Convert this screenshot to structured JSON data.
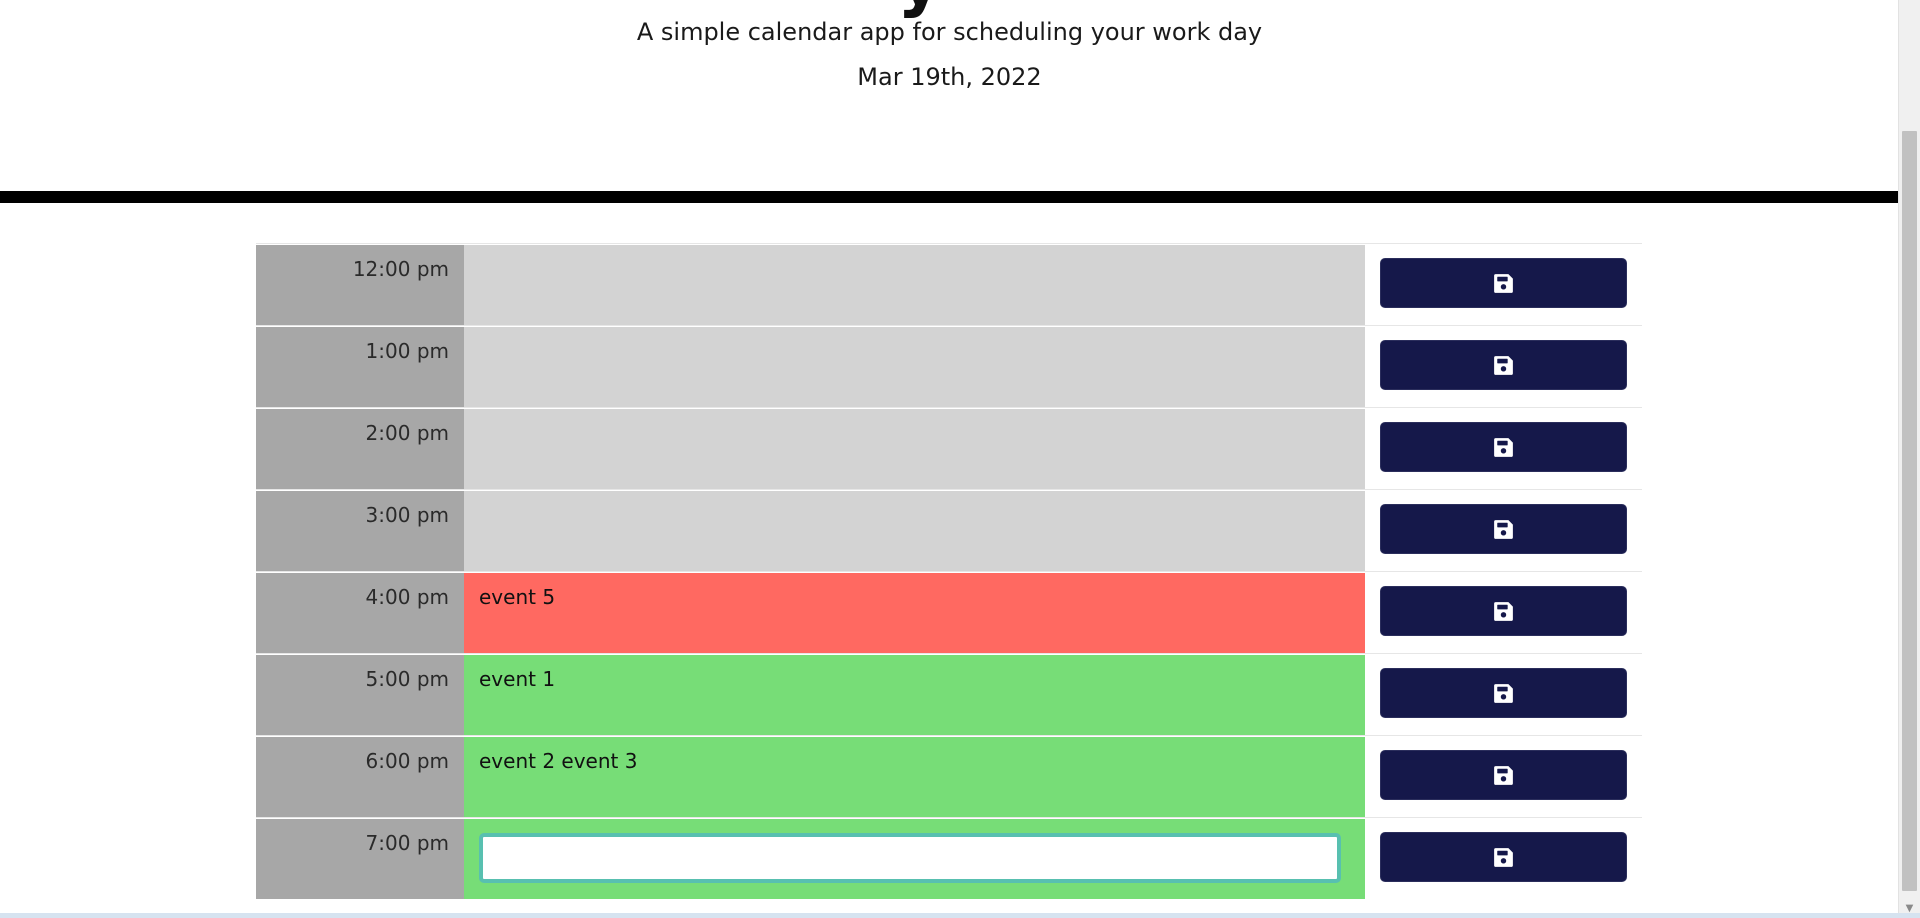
{
  "header": {
    "title_fragment": "y",
    "subtitle": "A simple calendar app for scheduling your work day",
    "current_date": "Mar 19th, 2022"
  },
  "colors": {
    "past": "#d3d3d3",
    "present": "#ff6961",
    "future": "#77dd77",
    "hour_column": "#a7a7a7",
    "save_button": "#15184a",
    "input_focus_border": "#58c0b0"
  },
  "time_blocks": [
    {
      "hour": "12:00 pm",
      "text": "",
      "state": "past"
    },
    {
      "hour": "1:00 pm",
      "text": "",
      "state": "past"
    },
    {
      "hour": "2:00 pm",
      "text": "",
      "state": "past"
    },
    {
      "hour": "3:00 pm",
      "text": "",
      "state": "past"
    },
    {
      "hour": "4:00 pm",
      "text": "event 5",
      "state": "present"
    },
    {
      "hour": "5:00 pm",
      "text": "event 1",
      "state": "future"
    },
    {
      "hour": "6:00 pm",
      "text": "event 2 event 3",
      "state": "future"
    },
    {
      "hour": "7:00 pm",
      "text": "",
      "state": "future",
      "editing": true,
      "input_value": ""
    }
  ],
  "save_button_icon": "floppy-disk-icon"
}
